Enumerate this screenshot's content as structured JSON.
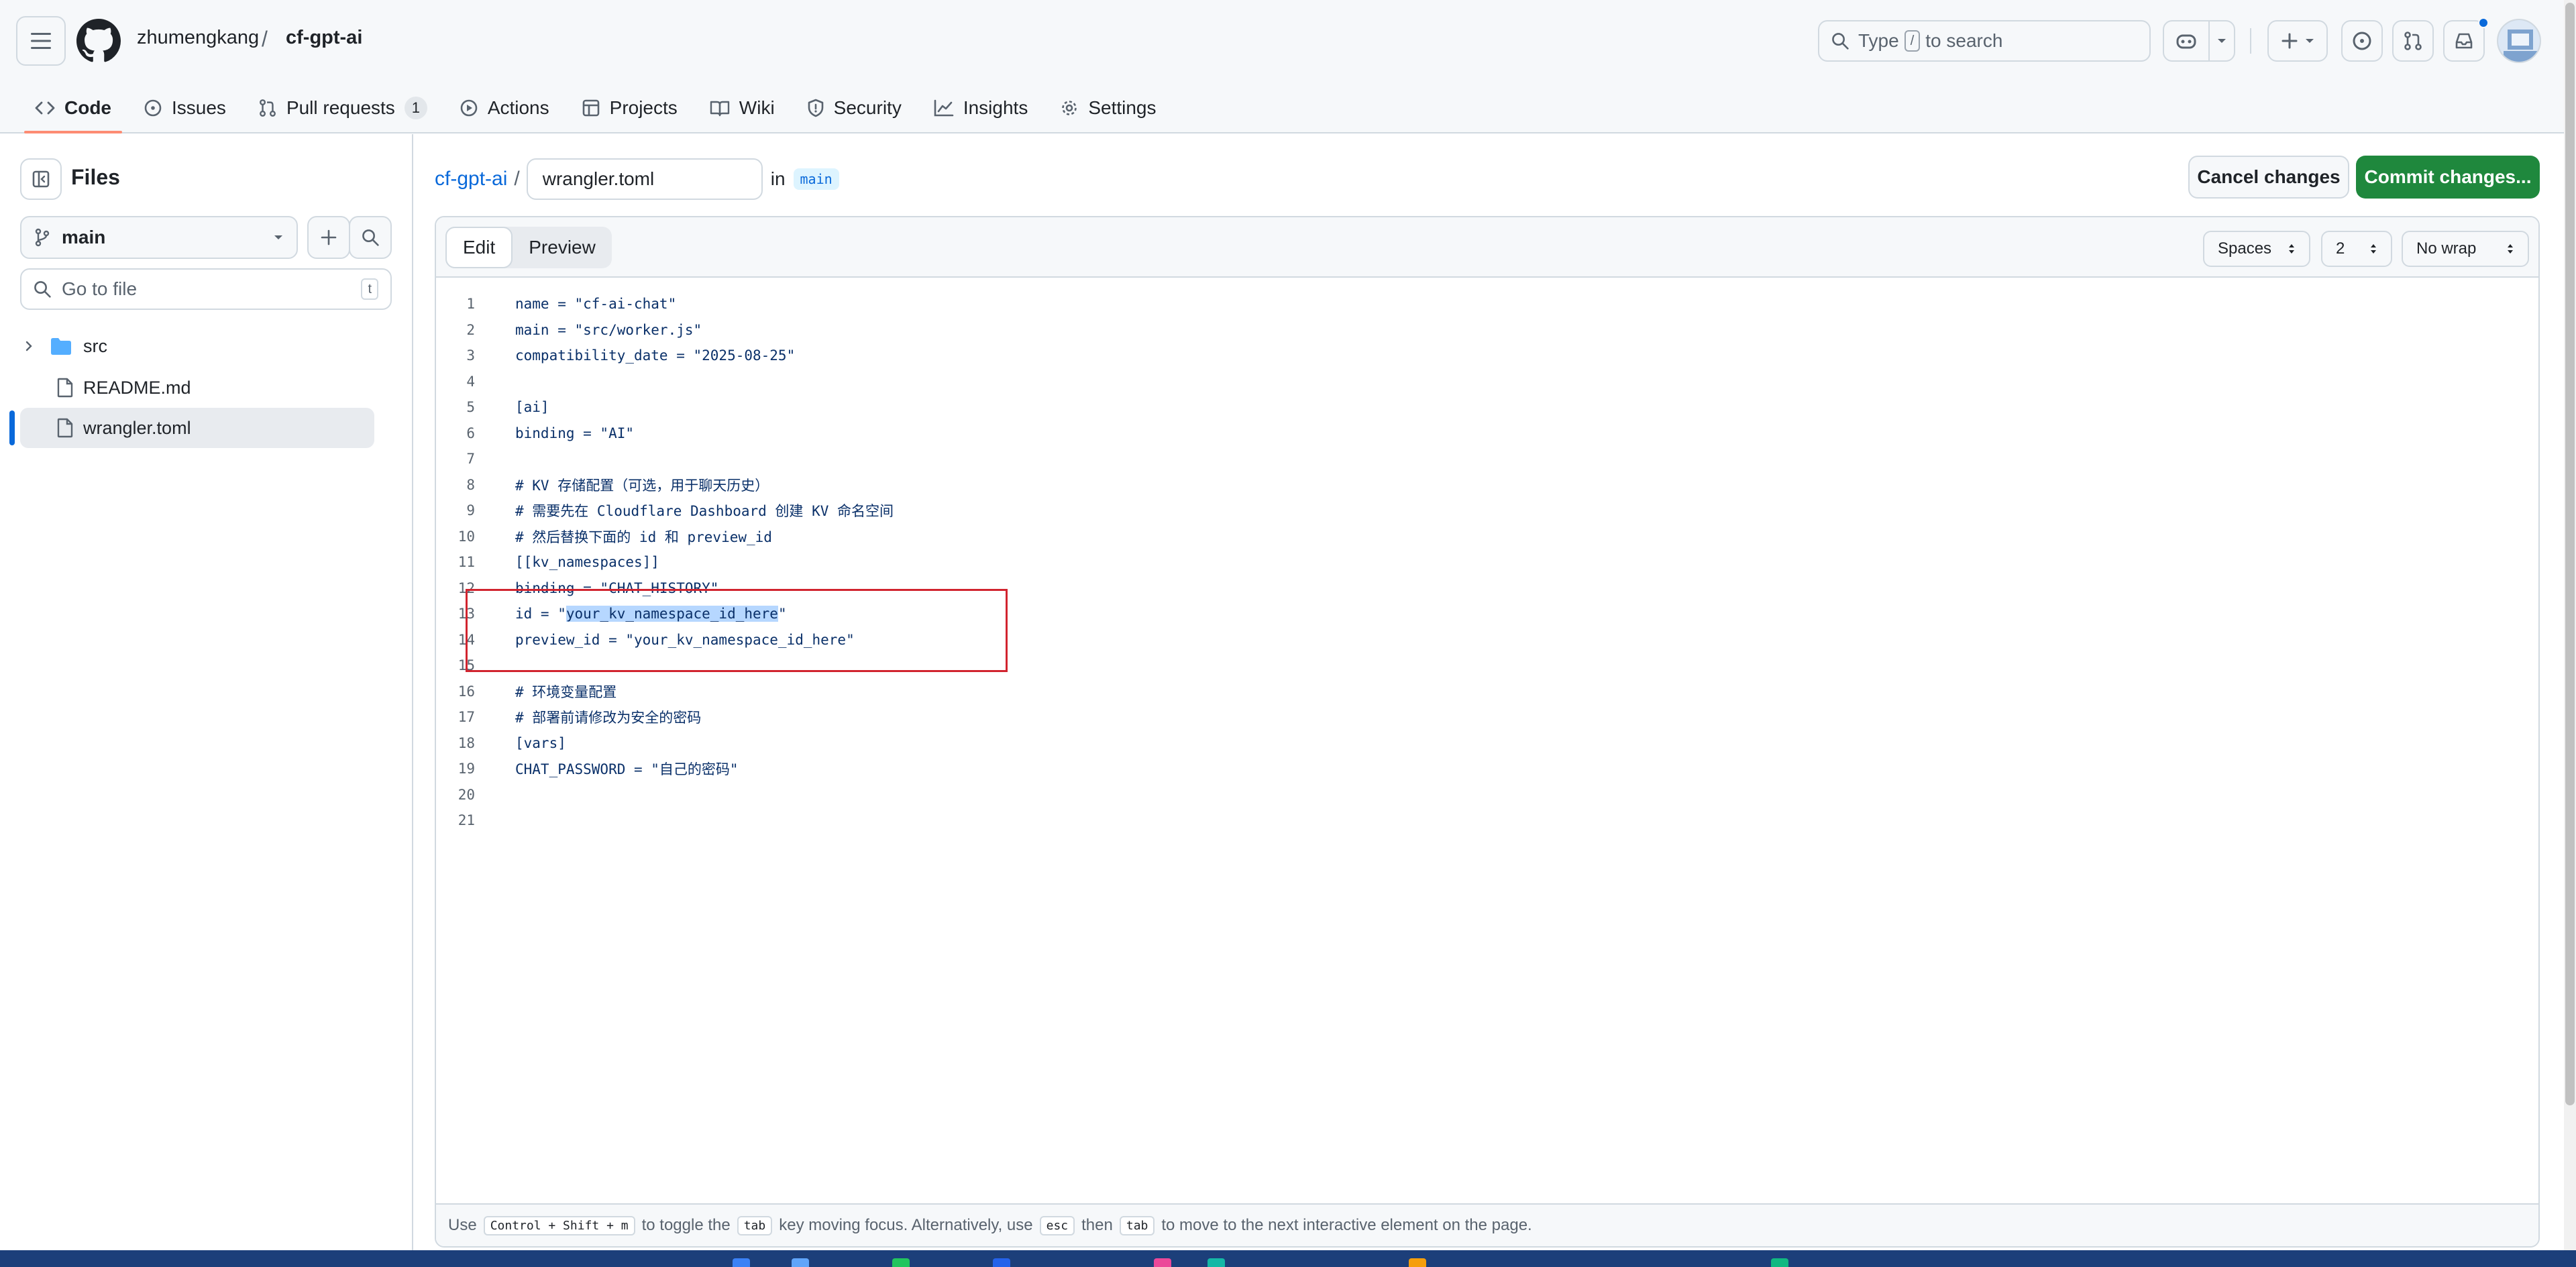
{
  "header": {
    "owner": "zhumengkang",
    "separator": "/",
    "repo": "cf-gpt-ai",
    "search_prefix": "Type",
    "search_key": "/",
    "search_suffix": "to search"
  },
  "nav": {
    "code": "Code",
    "issues": "Issues",
    "pulls": "Pull requests",
    "pulls_count": "1",
    "actions": "Actions",
    "projects": "Projects",
    "wiki": "Wiki",
    "security": "Security",
    "insights": "Insights",
    "settings": "Settings"
  },
  "sidebar": {
    "title": "Files",
    "branch": "main",
    "goto_placeholder": "Go to file",
    "goto_key": "t",
    "tree": [
      {
        "name": "src",
        "type": "folder"
      },
      {
        "name": "README.md",
        "type": "file"
      },
      {
        "name": "wrangler.toml",
        "type": "file",
        "selected": true
      }
    ]
  },
  "editor_header": {
    "repo_link": "cf-gpt-ai",
    "slash": "/",
    "filename": "wrangler.toml",
    "in_text": "in",
    "branch": "main",
    "cancel": "Cancel changes",
    "commit": "Commit changes..."
  },
  "editor": {
    "tab_edit": "Edit",
    "tab_preview": "Preview",
    "indent_mode": "Spaces",
    "indent_size": "2",
    "wrap_mode": "No wrap",
    "lines": [
      "name = \"cf-ai-chat\"",
      "main = \"src/worker.js\"",
      "compatibility_date = \"2025-08-25\"",
      "",
      "[ai]",
      "binding = \"AI\"",
      "",
      "# KV 存储配置（可选，用于聊天历史）",
      "# 需要先在 Cloudflare Dashboard 创建 KV 命名空间",
      "# 然后替换下面的 id 和 preview_id",
      "[[kv_namespaces]]",
      "binding = \"CHAT_HISTORY\"",
      "id = \"your_kv_namespace_id_here\"",
      "preview_id = \"your_kv_namespace_id_here\"",
      "",
      "# 环境变量配置",
      "# 部署前请修改为安全的密码",
      "[vars]",
      "CHAT_PASSWORD = \"自己的密码\"",
      "",
      ""
    ],
    "highlight": {
      "line": 13,
      "prefix": "id = \"",
      "text": "your_kv_namespace_id_here",
      "suffix": "\""
    }
  },
  "footer": {
    "t1": "Use",
    "k1": "Control + Shift + m",
    "t2": "to toggle the",
    "k2": "tab",
    "t3": "key moving focus. Alternatively, use",
    "k3": "esc",
    "t4": "then",
    "k4": "tab",
    "t5": "to move to the next interactive element on the page."
  },
  "colors": {
    "accent": "#0969da",
    "commit_green": "#1f883d",
    "highlight_box": "#d1242f",
    "selection": "#b6d7ff"
  }
}
